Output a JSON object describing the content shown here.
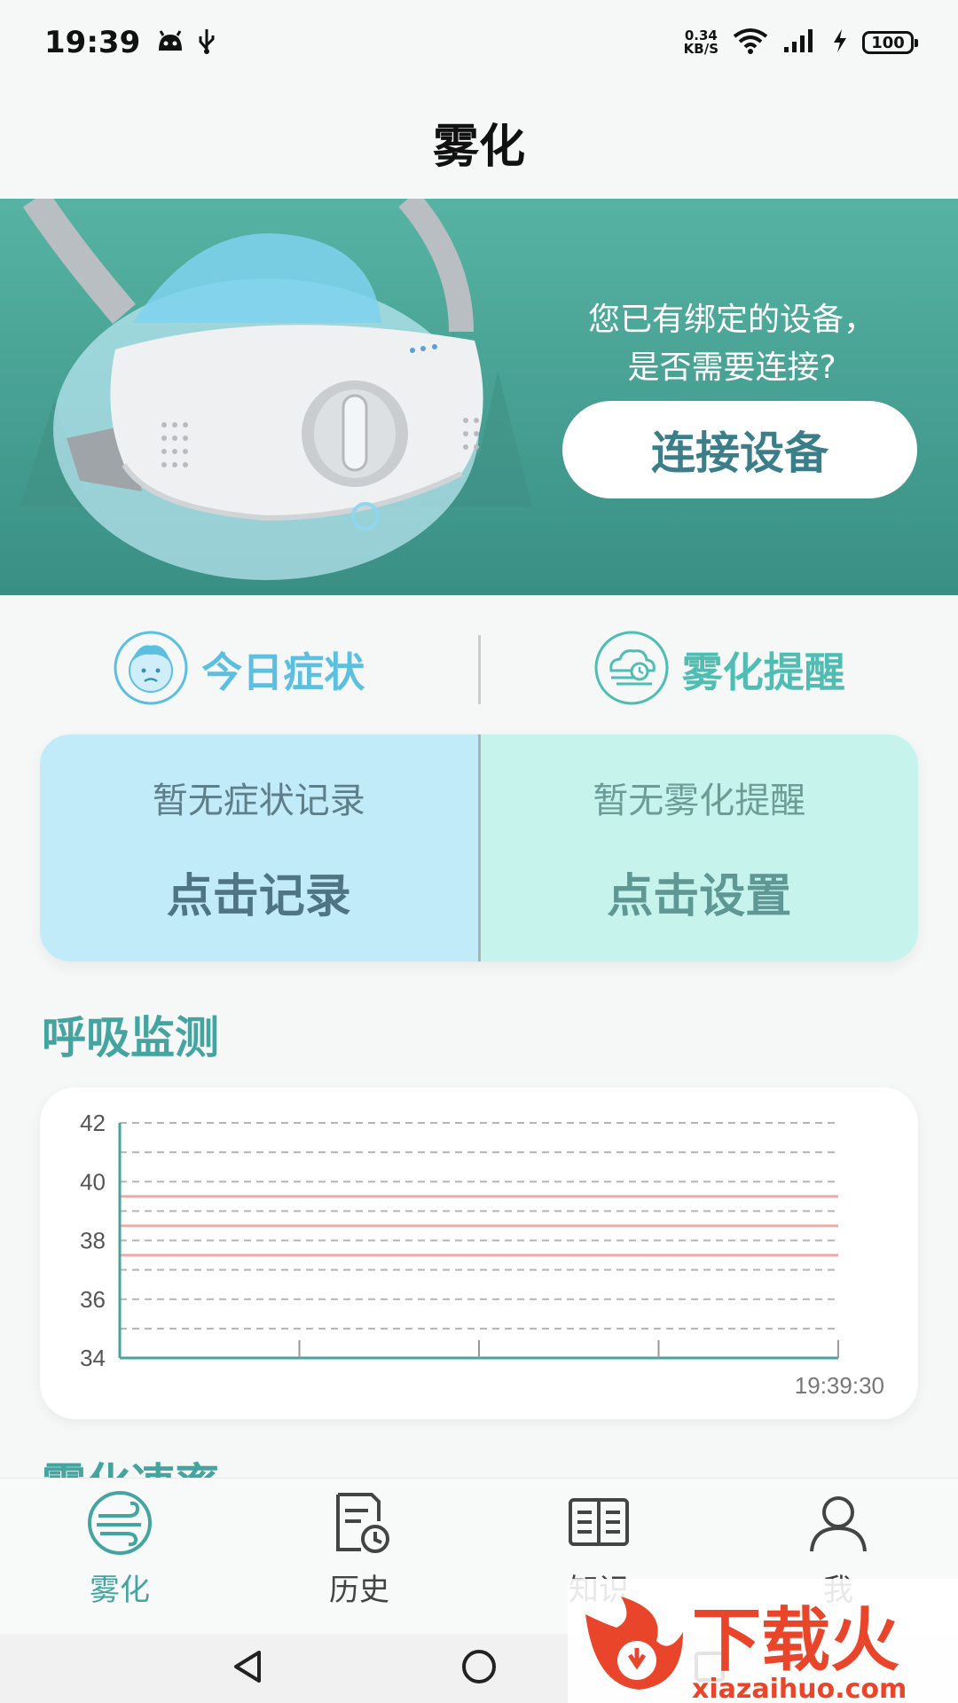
{
  "status_bar": {
    "time": "19:39",
    "net_speed_value": "0.34",
    "net_speed_unit": "KB/S",
    "battery": "100"
  },
  "header": {
    "title": "雾化"
  },
  "banner": {
    "line1": "您已有绑定的设备，",
    "line2": "是否需要连接?",
    "connect_label": "连接设备"
  },
  "tabs": [
    {
      "label": "今日症状",
      "icon": "child-face-icon"
    },
    {
      "label": "雾化提醒",
      "icon": "cloud-mist-icon"
    }
  ],
  "cards": {
    "symptom": {
      "subtitle": "暂无症状记录",
      "action": "点击记录"
    },
    "reminder": {
      "subtitle": "暂无雾化提醒",
      "action": "点击设置"
    }
  },
  "sections": {
    "breath": "呼吸监测",
    "speed": "雾化速率"
  },
  "chart_data": {
    "type": "line",
    "y_ticks": [
      "42",
      "40",
      "38",
      "36",
      "34"
    ],
    "ylim": [
      34,
      42
    ],
    "x_label_last": "19:39:30",
    "reference_lines": [
      39.5,
      38.5,
      37.5
    ],
    "grid_dashed": true,
    "series": []
  },
  "bottom_nav": [
    {
      "label": "雾化",
      "icon": "nebulizer-icon",
      "active": true
    },
    {
      "label": "历史",
      "icon": "history-icon",
      "active": false
    },
    {
      "label": "知识",
      "icon": "book-icon",
      "active": false
    },
    {
      "label": "我",
      "icon": "user-icon",
      "active": false
    }
  ],
  "watermark": {
    "logo_text": "下载火",
    "url": "xiazaihuo.com"
  },
  "colors": {
    "accent": "#44a5a0",
    "banner": "#4ea99a",
    "reference_line": "#f0a9a4"
  }
}
